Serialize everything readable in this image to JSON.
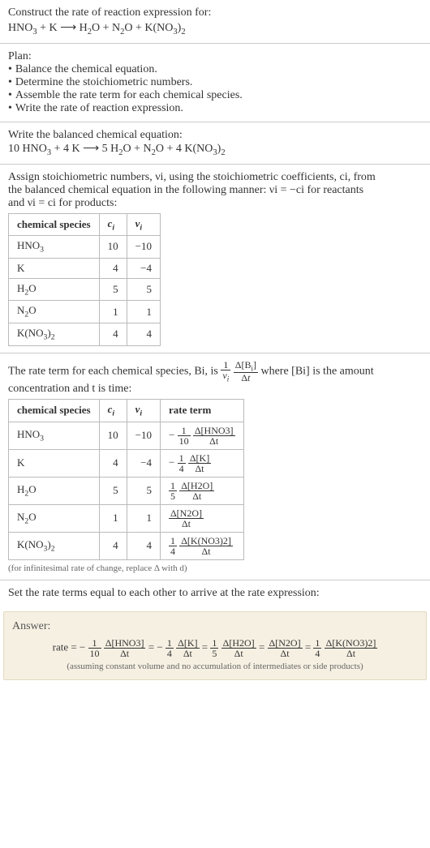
{
  "header": {
    "construct": "Construct the rate of reaction expression for:",
    "equation": "HNO3 + K ⟶ H2O + N2O + K(NO3)2"
  },
  "plan": {
    "title": "Plan:",
    "items": [
      "Balance the chemical equation.",
      "Determine the stoichiometric numbers.",
      "Assemble the rate term for each chemical species.",
      "Write the rate of reaction expression."
    ]
  },
  "balanced": {
    "title": "Write the balanced chemical equation:",
    "equation": "10 HNO3 + 4 K ⟶ 5 H2O + N2O + 4 K(NO3)2"
  },
  "assign": {
    "intro_line1": "Assign stoichiometric numbers, νi, using the stoichiometric coefficients, ci, from",
    "intro_line2": "the balanced chemical equation in the following manner: νi = −ci for reactants",
    "intro_line3": "and νi = ci for products:",
    "headers": [
      "chemical species",
      "ci",
      "νi"
    ],
    "rows": [
      {
        "sp": "HNO3",
        "c": "10",
        "v": "−10"
      },
      {
        "sp": "K",
        "c": "4",
        "v": "−4"
      },
      {
        "sp": "H2O",
        "c": "5",
        "v": "5"
      },
      {
        "sp": "N2O",
        "c": "1",
        "v": "1"
      },
      {
        "sp": "K(NO3)2",
        "c": "4",
        "v": "4"
      }
    ]
  },
  "rateterm": {
    "intro_line1": "The rate term for each chemical species, Bi, is",
    "intro_line2": "where [Bi] is the amount",
    "intro_line3": "concentration and t is time:",
    "headers": [
      "chemical species",
      "ci",
      "νi",
      "rate term"
    ],
    "rows": [
      {
        "sp": "HNO3",
        "c": "10",
        "v": "−10",
        "coef": "−",
        "fn": "1",
        "fd": "10",
        "dnum": "Δ[HNO3]",
        "dden": "Δt"
      },
      {
        "sp": "K",
        "c": "4",
        "v": "−4",
        "coef": "−",
        "fn": "1",
        "fd": "4",
        "dnum": "Δ[K]",
        "dden": "Δt"
      },
      {
        "sp": "H2O",
        "c": "5",
        "v": "5",
        "coef": "",
        "fn": "1",
        "fd": "5",
        "dnum": "Δ[H2O]",
        "dden": "Δt"
      },
      {
        "sp": "N2O",
        "c": "1",
        "v": "1",
        "coef": "",
        "fn": "",
        "fd": "",
        "dnum": "Δ[N2O]",
        "dden": "Δt"
      },
      {
        "sp": "K(NO3)2",
        "c": "4",
        "v": "4",
        "coef": "",
        "fn": "1",
        "fd": "4",
        "dnum": "Δ[K(NO3)2]",
        "dden": "Δt"
      }
    ],
    "note": "(for infinitesimal rate of change, replace Δ with d)"
  },
  "final": {
    "title": "Set the rate terms equal to each other to arrive at the rate expression:"
  },
  "answer": {
    "label": "Answer:",
    "prefix": "rate =",
    "terms": [
      {
        "sign": "−",
        "fn": "1",
        "fd": "10",
        "dnum": "Δ[HNO3]",
        "dden": "Δt"
      },
      {
        "sign": "−",
        "fn": "1",
        "fd": "4",
        "dnum": "Δ[K]",
        "dden": "Δt"
      },
      {
        "sign": "",
        "fn": "1",
        "fd": "5",
        "dnum": "Δ[H2O]",
        "dden": "Δt"
      },
      {
        "sign": "",
        "fn": "",
        "fd": "",
        "dnum": "Δ[N2O]",
        "dden": "Δt"
      },
      {
        "sign": "",
        "fn": "1",
        "fd": "4",
        "dnum": "Δ[K(NO3)2]",
        "dden": "Δt"
      }
    ],
    "assumption": "(assuming constant volume and no accumulation of intermediates or side products)"
  }
}
